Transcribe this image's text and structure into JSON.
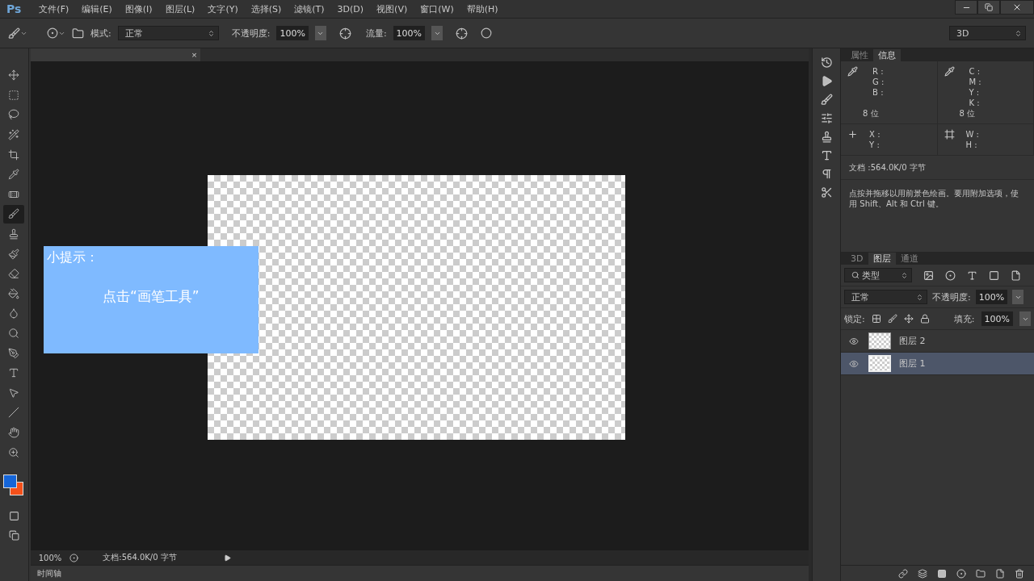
{
  "app": {
    "badge": "Ps"
  },
  "menu": [
    "文件(F)",
    "编辑(E)",
    "图像(I)",
    "图层(L)",
    "文字(Y)",
    "选择(S)",
    "滤镜(T)",
    "3D(D)",
    "视图(V)",
    "窗口(W)",
    "帮助(H)"
  ],
  "options_bar": {
    "mode_label": "模式:",
    "mode_value": "正常",
    "opacity_label": "不透明度:",
    "opacity_value": "100%",
    "flow_label": "流量:",
    "flow_value": "100%",
    "workspace": "3D"
  },
  "document_tab": {
    "close": "×"
  },
  "tools": [
    {
      "kind": "move",
      "selected": false
    },
    {
      "kind": "marquee",
      "selected": false
    },
    {
      "kind": "lasso",
      "selected": false
    },
    {
      "kind": "wand",
      "selected": false
    },
    {
      "kind": "crop",
      "selected": false
    },
    {
      "kind": "eyedropper",
      "selected": false
    },
    {
      "kind": "heal",
      "selected": false
    },
    {
      "kind": "brush",
      "selected": true
    },
    {
      "kind": "stamp",
      "selected": false
    },
    {
      "kind": "history",
      "selected": false
    },
    {
      "kind": "eraser",
      "selected": false
    },
    {
      "kind": "bucket",
      "selected": false
    },
    {
      "kind": "blur",
      "selected": false
    },
    {
      "kind": "dodge",
      "selected": false
    },
    {
      "kind": "pen",
      "selected": false
    },
    {
      "kind": "type",
      "selected": false
    },
    {
      "kind": "select",
      "selected": false
    },
    {
      "kind": "line",
      "selected": false
    },
    {
      "kind": "hand",
      "selected": false
    },
    {
      "kind": "zoom",
      "selected": false
    }
  ],
  "swatches": [
    {
      "kind": "foreground",
      "color": "#1565d8"
    },
    {
      "kind": "background",
      "color": "#f4501a"
    }
  ],
  "hint": {
    "title": "小提示：",
    "text": "点击“画笔工具”"
  },
  "status_bar": {
    "zoom": "100%",
    "doc_size": "文档:564.0K/0 字节"
  },
  "timeline": {
    "label": "时间轴"
  },
  "info_panel": {
    "tabs": [
      {
        "label": "属性",
        "selected": false
      },
      {
        "label": "信息",
        "selected": true
      }
    ],
    "rgb": [
      "R :",
      "G :",
      "B :"
    ],
    "rgb_bits": "8 位",
    "cmyk": [
      "C :",
      "M :",
      "Y :",
      "K :"
    ],
    "cmyk_bits": "8 位",
    "xy": [
      "X :",
      "Y :"
    ],
    "wh": [
      "W :",
      "H :"
    ],
    "doc_size": "文档 :564.0K/0 字节",
    "tip": "点按并拖移以用前景色绘画。要用附加选项，使用 Shift、Alt 和 Ctrl 键。"
  },
  "layers_panel": {
    "tabs": [
      {
        "label": "3D",
        "selected": false
      },
      {
        "label": "图层",
        "selected": true
      },
      {
        "label": "通道",
        "selected": false
      }
    ],
    "filter": "类型",
    "blend_mode": "正常",
    "opacity_label": "不透明度:",
    "opacity_value": "100%",
    "lock_label": "锁定:",
    "fill_label": "填充:",
    "fill_value": "100%",
    "layers": [
      {
        "name": "图层 2",
        "visible": true,
        "selected": false
      },
      {
        "name": "图层 1",
        "visible": true,
        "selected": true
      }
    ]
  }
}
